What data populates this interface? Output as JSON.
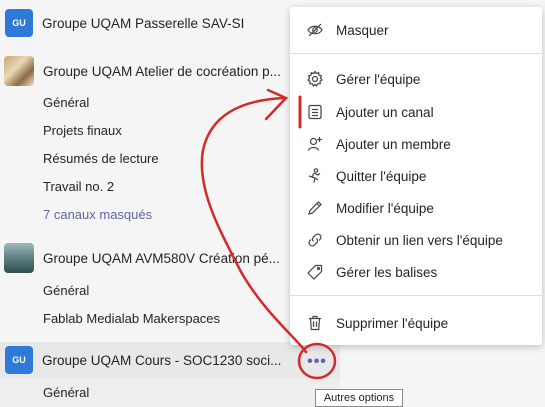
{
  "teams": [
    {
      "avatar_text": "GU",
      "name": "Groupe UQAM Passerelle SAV-SI"
    },
    {
      "avatar_text": "",
      "name": "Groupe UQAM Atelier de cocréation p...",
      "channels": [
        "Général",
        "Projets finaux",
        "Résumés de lecture",
        "Travail no. 2"
      ],
      "hidden_channels": "7 canaux masqués"
    },
    {
      "avatar_text": "",
      "name": "Groupe UQAM AVM580V Création pé...",
      "channels": [
        "Général",
        "Fablab Medialab Makerspaces"
      ]
    },
    {
      "avatar_text": "GU",
      "name": "Groupe UQAM Cours - SOC1230 soci...",
      "channels": [
        "Général"
      ]
    }
  ],
  "more_button": {
    "label": "•••"
  },
  "tooltip": {
    "text": "Autres options"
  },
  "menu": {
    "items": [
      {
        "icon": "eye-slash-icon",
        "label": "Masquer"
      },
      {
        "icon": "gear-icon",
        "label": "Gérer l'équipe"
      },
      {
        "icon": "channel-icon",
        "label": "Ajouter un canal"
      },
      {
        "icon": "add-person-icon",
        "label": "Ajouter un membre"
      },
      {
        "icon": "leave-icon",
        "label": "Quitter l'équipe"
      },
      {
        "icon": "pencil-icon",
        "label": "Modifier l'équipe"
      },
      {
        "icon": "link-icon",
        "label": "Obtenir un lien vers l'équipe"
      },
      {
        "icon": "tag-icon",
        "label": "Gérer les balises"
      },
      {
        "icon": "trash-icon",
        "label": "Supprimer l'équipe"
      }
    ]
  },
  "colors": {
    "accent": "#6264a7",
    "avatar_blue": "#2f7ad9",
    "annotation_red": "#d42a2a"
  }
}
